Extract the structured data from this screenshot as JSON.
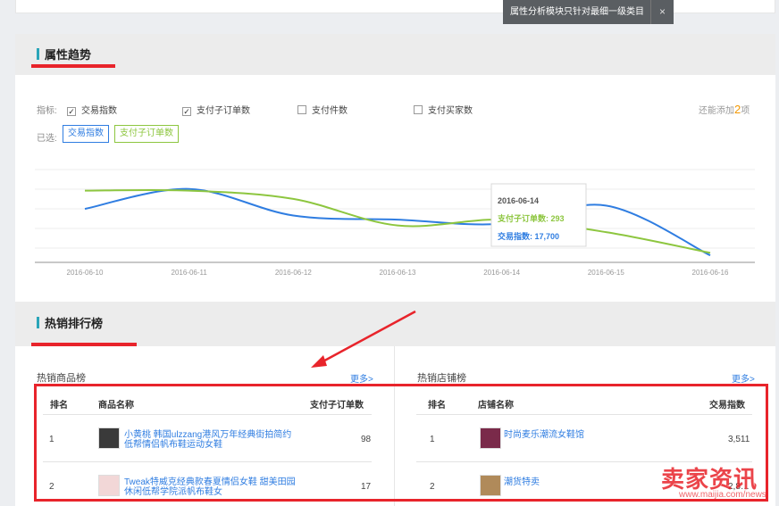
{
  "notice": {
    "text": "属性分析模块只针对最细一级类目",
    "close": "×"
  },
  "trend": {
    "title": "属性趋势",
    "metric_label": "指标:",
    "metrics": [
      {
        "label": "交易指数",
        "checked": true
      },
      {
        "label": "支付子订单数",
        "checked": true
      },
      {
        "label": "支付件数",
        "checked": false
      },
      {
        "label": "支付买家数",
        "checked": false
      }
    ],
    "add_more_prefix": "还能添加",
    "add_more_count": "2",
    "add_more_suffix": "项",
    "selected_label": "已选:",
    "selected_tags": [
      "交易指数",
      "支付子订单数"
    ]
  },
  "chart_data": {
    "type": "line",
    "x": [
      "2016-06-10",
      "2016-06-11",
      "2016-06-12",
      "2016-06-13",
      "2016-06-14",
      "2016-06-15",
      "2016-06-16"
    ],
    "series": [
      {
        "name": "交易指数",
        "color": "#2f7de1",
        "values": [
          0.58,
          0.82,
          0.5,
          0.45,
          0.4,
          0.62,
          0.02
        ]
      },
      {
        "name": "支付子订单数",
        "color": "#8dc63f",
        "values": [
          0.8,
          0.8,
          0.7,
          0.38,
          0.45,
          0.3,
          0.05
        ]
      }
    ],
    "tooltip": {
      "date": "2016-06-14",
      "rows": [
        {
          "label": "支付子订单数:",
          "value": "293",
          "color": "#8dc63f"
        },
        {
          "label": "交易指数:",
          "value": "17,700",
          "color": "#2f7de1"
        }
      ]
    },
    "grid": true
  },
  "hot": {
    "title": "热销排行榜",
    "products": {
      "title": "热销商品榜",
      "more": "更多>",
      "headers": [
        "排名",
        "商品名称",
        "支付子订单数"
      ],
      "rows": [
        {
          "rank": "1",
          "name_line1": "小黄桃 韩国ulzzang港风万年经典街拍简约",
          "name_line2": "低帮情侣帆布鞋运动女鞋",
          "value": "98"
        },
        {
          "rank": "2",
          "name_line1": "Tweak特威克经典款春夏情侣女鞋 甜美田园",
          "name_line2": "休闲低帮学院派帆布鞋女",
          "value": "17"
        }
      ]
    },
    "shops": {
      "title": "热销店铺榜",
      "more": "更多>",
      "headers": [
        "排名",
        "店铺名称",
        "交易指数"
      ],
      "rows": [
        {
          "rank": "1",
          "name": "时尚麦乐潮流女鞋馆",
          "value": "3,511"
        },
        {
          "rank": "2",
          "name": "潮货特卖",
          "value": "2,8…"
        }
      ]
    }
  },
  "watermark": {
    "brand": "卖家资讯",
    "url": "www.maijia.com/news"
  }
}
